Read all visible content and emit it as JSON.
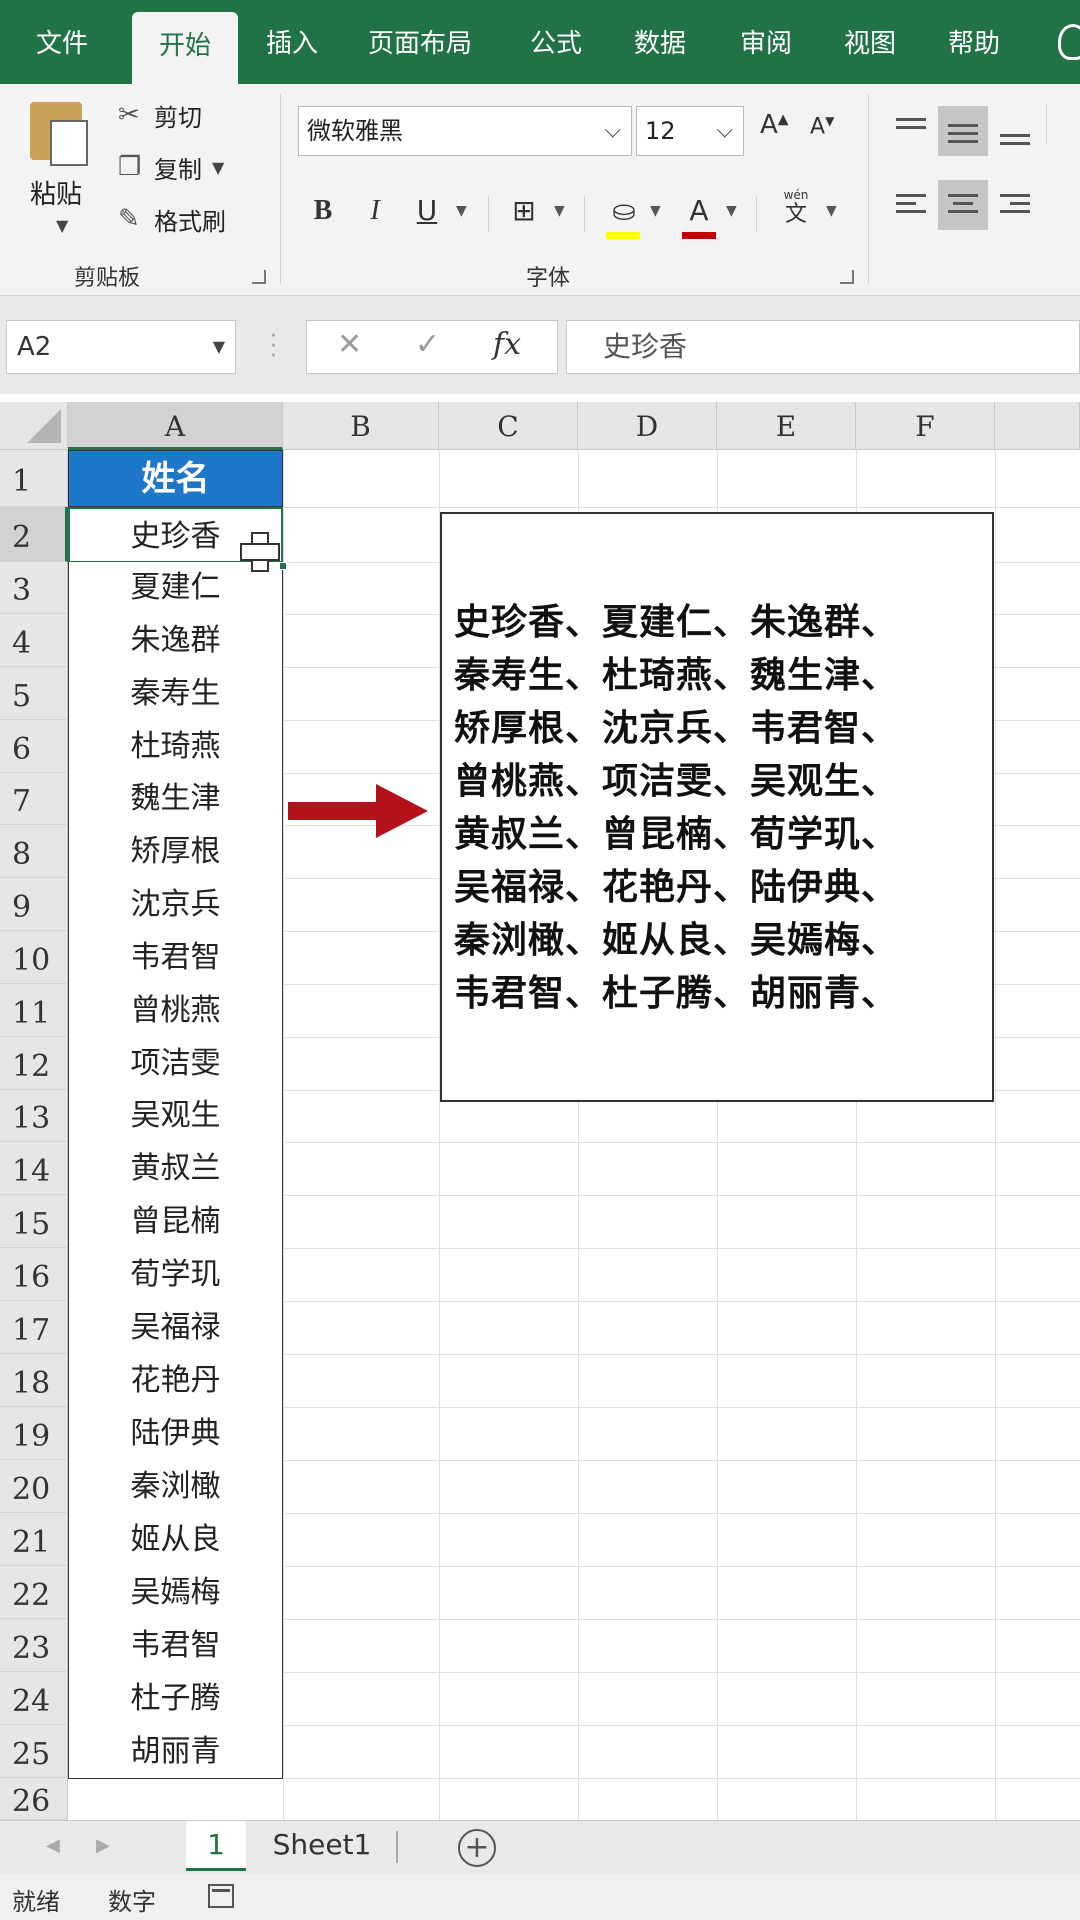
{
  "ribbon_tabs": [
    {
      "label": "文件",
      "active": false
    },
    {
      "label": "开始",
      "active": true
    },
    {
      "label": "插入",
      "active": false
    },
    {
      "label": "页面布局",
      "active": false
    },
    {
      "label": "公式",
      "active": false
    },
    {
      "label": "数据",
      "active": false
    },
    {
      "label": "审阅",
      "active": false
    },
    {
      "label": "视图",
      "active": false
    },
    {
      "label": "帮助",
      "active": false
    }
  ],
  "clipboard": {
    "paste": "粘贴",
    "cut": "剪切",
    "copy": "复制",
    "format_painter": "格式刷",
    "group_label": "剪贴板"
  },
  "font": {
    "name": "微软雅黑",
    "size": "12",
    "grow": "A",
    "shrink": "A",
    "bold": "B",
    "italic": "I",
    "underline": "U",
    "font_color_letter": "A",
    "phonetic": "wén",
    "phonetic_char": "文",
    "group_label": "字体"
  },
  "formula_bar": {
    "name_box": "A2",
    "cancel": "✕",
    "enter": "✓",
    "fx": "fx",
    "content": "史珍香"
  },
  "columns": [
    "A",
    "B",
    "C",
    "D",
    "E",
    "F"
  ],
  "row_numbers": [
    "1",
    "2",
    "3",
    "4",
    "5",
    "6",
    "7",
    "8",
    "9",
    "10",
    "11",
    "12",
    "13",
    "14",
    "15",
    "16",
    "17",
    "18",
    "19",
    "20",
    "21",
    "22",
    "23",
    "24",
    "25",
    "26"
  ],
  "column_a": {
    "header": "姓名",
    "names": [
      "史珍香",
      "夏建仁",
      "朱逸群",
      "秦寿生",
      "杜琦燕",
      "魏生津",
      "矫厚根",
      "沈京兵",
      "韦君智",
      "曾桃燕",
      "项洁雯",
      "吴观生",
      "黄叔兰",
      "曾昆楠",
      "荀学玑",
      "吴福禄",
      "花艳丹",
      "陆伊典",
      "秦浏橄",
      "姬从良",
      "吴嫣梅",
      "韦君智",
      "杜子腾",
      "胡丽青"
    ]
  },
  "text_box": {
    "lines": [
      "史珍香、夏建仁、朱逸群、",
      "秦寿生、杜琦燕、魏生津、",
      "矫厚根、沈京兵、韦君智、",
      "曾桃燕、项洁雯、吴观生、",
      "黄叔兰、曾昆楠、荀学玑、",
      "吴福禄、花艳丹、陆伊典、",
      "秦浏橄、姬从良、吴嫣梅、",
      "韦君智、杜子腾、胡丽青、"
    ]
  },
  "sheet_tabs": [
    {
      "label": "1",
      "active": true
    },
    {
      "label": "Sheet1",
      "active": false
    }
  ],
  "add_sheet": "+",
  "status": {
    "ready": "就绪",
    "mode": "数字"
  },
  "colors": {
    "excel_green": "#217346",
    "header_fill": "#1f77c9",
    "arrow": "#b3121b"
  }
}
